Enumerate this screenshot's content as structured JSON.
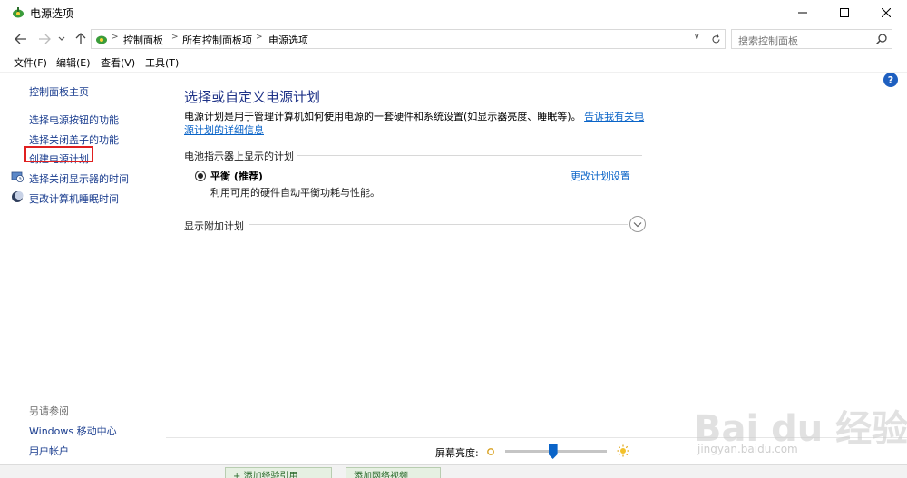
{
  "window": {
    "title": "电源选项"
  },
  "address": {
    "crumbs": [
      "控制面板",
      "所有控制面板项",
      "电源选项"
    ],
    "search_placeholder": "搜索控制面板"
  },
  "menu": [
    "文件(F)",
    "编辑(E)",
    "查看(V)",
    "工具(T)"
  ],
  "sidebar": {
    "home": "控制面板主页",
    "links": [
      "选择电源按钮的功能",
      "选择关闭盖子的功能",
      "创建电源计划",
      "选择关闭显示器的时间",
      "更改计算机睡眠时间"
    ],
    "see_also_heading": "另请参阅",
    "see_also": [
      "Windows 移动中心",
      "用户帐户"
    ]
  },
  "main": {
    "title": "选择或自定义电源计划",
    "description": "电源计划是用于管理计算机如何使用电源的一套硬件和系统设置(如显示器亮度、睡眠等)。",
    "description_link": "告诉我有关电源计划的详细信息",
    "battery_section": "电池指示器上显示的计划",
    "plan_name": "平衡 (推荐)",
    "plan_desc": "利用可用的硬件自动平衡功耗与性能。",
    "plan_link": "更改计划设置",
    "extra_section": "显示附加计划",
    "brightness_label": "屏幕亮度:",
    "brightness_level": 0.47
  },
  "taskstrip": [
    "+ 添加经验引用",
    "添加网络视频"
  ],
  "watermark": {
    "brand": "Bai du 经验",
    "url": "jingyan.baidu.com"
  },
  "colors": {
    "link": "#0a64c8",
    "title": "#1e3287",
    "highlight": "#e02020",
    "sidebar_link": "#1a3d8f"
  }
}
